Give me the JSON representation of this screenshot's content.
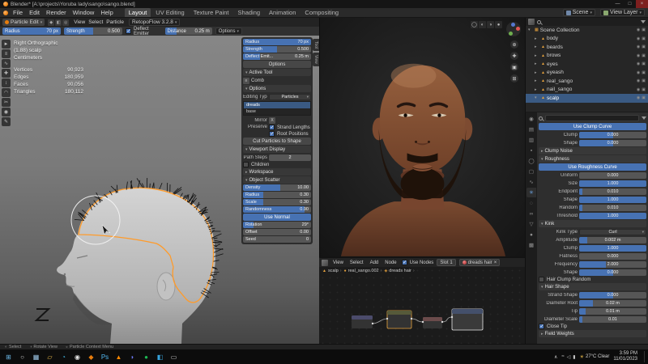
{
  "titlebar": {
    "title": "Blender* [A:\\projects\\Yoruba lady\\sango\\sango.blend]",
    "minimize": "—",
    "maximize": "□",
    "close": "×"
  },
  "menubar": {
    "menus": [
      "File",
      "Edit",
      "Render",
      "Window",
      "Help"
    ],
    "workspaces": [
      {
        "label": "Layout",
        "active": true
      },
      {
        "label": "UV Editing"
      },
      {
        "label": "Texture Paint"
      },
      {
        "label": "Shading"
      },
      {
        "label": "Animation"
      },
      {
        "label": "Compositing"
      }
    ],
    "scene": "Scene",
    "view_layer": "View Layer"
  },
  "viewport": {
    "header": {
      "mode": "Particle Edit",
      "menus": [
        "View",
        "Select",
        "Particle"
      ],
      "addon": "RetopoFlow 3.2.8"
    },
    "tools": {
      "sliders": [
        {
          "label": "Radius",
          "value": "70 px",
          "fill": 100
        },
        {
          "label": "Strength",
          "value": "0.500",
          "fill": 50
        }
      ],
      "deflect": {
        "label": "Deflect Emitter",
        "checked": true
      },
      "distance": {
        "label": "Distance",
        "value": "0.25 m",
        "fill": 25
      },
      "options": "Options"
    },
    "toolbar_icons": [
      {
        "name": "cursor-tool-icon",
        "glyph": "►"
      },
      {
        "name": "comb-tool-icon",
        "glyph": "≡"
      },
      {
        "name": "smooth-tool-icon",
        "glyph": "∿"
      },
      {
        "name": "add-tool-icon",
        "glyph": "✚"
      },
      {
        "name": "length-tool-icon",
        "glyph": "↕"
      },
      {
        "name": "puff-tool-icon",
        "glyph": "◠"
      },
      {
        "name": "cut-tool-icon",
        "glyph": "✂"
      },
      {
        "name": "weight-tool-icon",
        "glyph": "◉"
      },
      {
        "name": "annotate-tool-icon",
        "glyph": "✎"
      }
    ],
    "overlay": {
      "lines": [
        "Right Orthographic",
        "(1.88) scalp",
        "Centimeters"
      ],
      "stats": [
        {
          "label": "Vertices",
          "value": "90,923"
        },
        {
          "label": "Edges",
          "value": "180,959"
        },
        {
          "label": "Faces",
          "value": "90,056"
        },
        {
          "label": "Triangles",
          "value": "180,112"
        }
      ]
    },
    "npanel": {
      "top_sliders": [
        {
          "label": "Radius",
          "value": "70 px",
          "fill": 100
        },
        {
          "label": "Strength",
          "value": "0.500",
          "fill": 50
        },
        {
          "label": "Deflect Emit...",
          "value": "0.25 m",
          "fill": 25
        }
      ],
      "options_btn": "Options",
      "active_tool_header": "Active Tool",
      "tool_name": "Comb",
      "options_header": "Options",
      "editing_type": {
        "label": "Editing Type",
        "value": "Particles"
      },
      "systems": [
        {
          "name": "dreads",
          "active": true
        },
        {
          "name": "base"
        }
      ],
      "mirror": {
        "label": "Mirror",
        "x": "X"
      },
      "preserve": {
        "label": "Preserve",
        "options": [
          {
            "label": "Strand Lengths",
            "checked": true
          },
          {
            "label": "Root Positions",
            "checked": true
          }
        ]
      },
      "cut_button": "Cut Particles to Shape",
      "viewport_display_header": "Viewport Display",
      "path_steps": {
        "label": "Path Steps",
        "value": "2"
      },
      "children": {
        "label": "Children",
        "checked": false
      },
      "workspace_header": "Workspace",
      "object_scatter_header": "Object Scatter",
      "scatter_sliders": [
        {
          "label": "Density",
          "value": "10.00",
          "fill": 55
        },
        {
          "label": "Radius",
          "value": "0.30",
          "fill": 30
        },
        {
          "label": "Scale",
          "value": "0.30",
          "fill": 30
        },
        {
          "label": "Randomness",
          "value": "0.90",
          "fill": 90
        }
      ],
      "use_normal": "Use Normal",
      "transform_sliders": [
        {
          "label": "Rotation",
          "value": "29°",
          "fill": 16
        },
        {
          "label": "Offset",
          "value": "0.00",
          "fill": 0
        },
        {
          "label": "Seed",
          "value": "0",
          "fill": 0
        }
      ],
      "tabs": [
        "Tool",
        "View"
      ]
    }
  },
  "render_view": {
    "shading_icons": [
      {
        "name": "wireframe-shading-icon",
        "glyph": "◯"
      },
      {
        "name": "solid-shading-icon",
        "glyph": "◐"
      },
      {
        "name": "material-shading-icon",
        "glyph": "◑"
      },
      {
        "name": "rendered-shading-icon",
        "glyph": "●"
      }
    ],
    "side_icons": [
      {
        "name": "zoom-icon",
        "glyph": "⊕"
      },
      {
        "name": "move-view-icon",
        "glyph": "✚"
      },
      {
        "name": "camera-view-icon",
        "glyph": "▣"
      },
      {
        "name": "toggle-view-icon",
        "glyph": "⊞"
      }
    ]
  },
  "shader_editor": {
    "menus": [
      "View",
      "Select",
      "Add",
      "Node"
    ],
    "use_nodes": {
      "label": "Use Nodes",
      "checked": true
    },
    "slot": "Slot 1",
    "material": "dreads hair",
    "unlink": "×",
    "breadcrumb": [
      {
        "icon": "▲",
        "label": "scalp"
      },
      {
        "icon": "●",
        "label": "real_sango.002"
      },
      {
        "icon": "◈",
        "label": "dreads hair"
      }
    ]
  },
  "outliner": {
    "eye_glyph": "◉",
    "cam_glyph": "▣",
    "rows": [
      {
        "caret": "▾",
        "icon": "▦",
        "name": "Scene Collection",
        "depth": 0
      },
      {
        "caret": "▸",
        "icon": "▲",
        "name": "body",
        "depth": 1
      },
      {
        "caret": "▸",
        "icon": "▲",
        "name": "beards",
        "depth": 1
      },
      {
        "caret": "▸",
        "icon": "▲",
        "name": "brows",
        "depth": 1
      },
      {
        "caret": "▸",
        "icon": "▲",
        "name": "eyes",
        "depth": 1
      },
      {
        "caret": "▸",
        "icon": "▲",
        "name": "eyeash",
        "depth": 1
      },
      {
        "caret": "▸",
        "icon": "▲",
        "name": "real_sango",
        "depth": 1
      },
      {
        "caret": "▸",
        "icon": "▲",
        "name": "nail_sango",
        "depth": 1
      },
      {
        "caret": "▾",
        "icon": "▲",
        "name": "scalp",
        "depth": 1,
        "selected": true
      }
    ]
  },
  "properties": {
    "tabs": [
      {
        "name": "render-tab",
        "glyph": "◉"
      },
      {
        "name": "output-tab",
        "glyph": "▤"
      },
      {
        "name": "view-layer-tab",
        "glyph": "▥"
      },
      {
        "name": "scene-tab",
        "glyph": "▪"
      },
      {
        "name": "world-tab",
        "glyph": "◯"
      },
      {
        "name": "object-tab",
        "glyph": "▢"
      },
      {
        "name": "modifiers-tab",
        "glyph": "∿"
      },
      {
        "name": "particles-tab",
        "glyph": "✳",
        "active": true
      },
      {
        "name": "physics-tab",
        "glyph": "◌"
      },
      {
        "name": "constraints-tab",
        "glyph": "∞"
      },
      {
        "name": "object-data-tab",
        "glyph": "▽"
      },
      {
        "name": "material-tab",
        "glyph": "●"
      },
      {
        "name": "texture-tab",
        "glyph": "▩"
      }
    ],
    "use_clump_curve": "Use Clump Curve",
    "clump_sliders": [
      {
        "label": "Clump",
        "value": "0.000",
        "fill": 50
      },
      {
        "label": "Shape",
        "value": "0.000",
        "fill": 50
      }
    ],
    "clump_noise_header": "Clump Noise",
    "roughness_header": "Roughness",
    "use_roughness_curve": "Use Roughness Curve",
    "roughness_sliders": [
      {
        "label": "Uniform",
        "value": "0.000",
        "fill": 0
      },
      {
        "label": "Size",
        "value": "1.000",
        "fill": 100
      },
      {
        "label": "Endpoint",
        "value": "0.010",
        "fill": 5
      },
      {
        "label": "Shape",
        "value": "1.000",
        "fill": 100
      },
      {
        "label": "Random",
        "value": "0.010",
        "fill": 5
      },
      {
        "label": "Threshold",
        "value": "1.000",
        "fill": 100
      }
    ],
    "kink_header": "Kink",
    "kink_type": {
      "label": "Kink Type",
      "value": "Curl"
    },
    "kink_sliders": [
      {
        "label": "Amplitude",
        "value": "0.002 m",
        "fill": 12
      },
      {
        "label": "Clump",
        "value": "1.000",
        "fill": 100
      },
      {
        "label": "Flatness",
        "value": "0.000",
        "fill": 0
      },
      {
        "label": "Frequency",
        "value": "2.000",
        "fill": 40
      },
      {
        "label": "Shape",
        "value": "0.000",
        "fill": 50
      }
    ],
    "hair_clump_random": {
      "label": "Hair Clump Random",
      "checked": false
    },
    "hair_shape_header": "Hair Shape",
    "hair_shape_sliders": [
      {
        "label": "Strand Shape",
        "value": "0.000",
        "fill": 50
      },
      {
        "label": "Diameter Root",
        "value": "0.02 m",
        "fill": 20
      },
      {
        "label": "Tip",
        "value": "0.01 m",
        "fill": 10
      },
      {
        "label": "Diameter Scale",
        "value": "0.01",
        "fill": 5
      }
    ],
    "close_tip": {
      "label": "Close Tip",
      "checked": true
    },
    "field_weights_header": "Field Weights"
  },
  "statusbar": {
    "hints": [
      {
        "icon": "◐",
        "label": "Select"
      },
      {
        "icon": "◑",
        "label": "Rotate View"
      },
      {
        "icon": "◒",
        "label": "Particle Context Menu"
      }
    ]
  },
  "taskbar": {
    "icons": [
      {
        "name": "start-button",
        "glyph": "⊞",
        "fg": "#6cb8e8"
      },
      {
        "name": "search-button",
        "glyph": "○",
        "fg": "#cfcfcf"
      },
      {
        "name": "task-view-button",
        "glyph": "▦",
        "fg": "#9ec7e8"
      },
      {
        "name": "file-explorer-icon",
        "glyph": "▱",
        "fg": "#f2c14b"
      },
      {
        "name": "edge-icon",
        "glyph": "◔",
        "fg": "#3fb2e0"
      },
      {
        "name": "chrome-icon",
        "glyph": "◉",
        "fg": "#e4e4e4"
      },
      {
        "name": "blender-icon",
        "glyph": "◆",
        "fg": "#e87d0d"
      },
      {
        "name": "photoshop-icon",
        "glyph": "Ps",
        "fg": "#53b9f2"
      },
      {
        "name": "vlc-icon",
        "glyph": "▲",
        "fg": "#ff8800"
      },
      {
        "name": "discord-icon",
        "glyph": "◗",
        "fg": "#6b78f2"
      },
      {
        "name": "spotify-icon",
        "glyph": "●",
        "fg": "#1db954"
      },
      {
        "name": "vscode-icon",
        "glyph": "◧",
        "fg": "#37a3dc"
      },
      {
        "name": "terminal-icon",
        "glyph": "▭",
        "fg": "#cccccc"
      }
    ],
    "tray": {
      "caret": "∧",
      "icons": [
        {
          "name": "network-icon",
          "glyph": "≈"
        },
        {
          "name": "volume-icon",
          "glyph": "◁"
        },
        {
          "name": "battery-icon",
          "glyph": "▮"
        }
      ],
      "weather_icon": "☀",
      "weather": "27°C Clear",
      "time": "3:59 PM",
      "date": "11/01/2023"
    }
  }
}
